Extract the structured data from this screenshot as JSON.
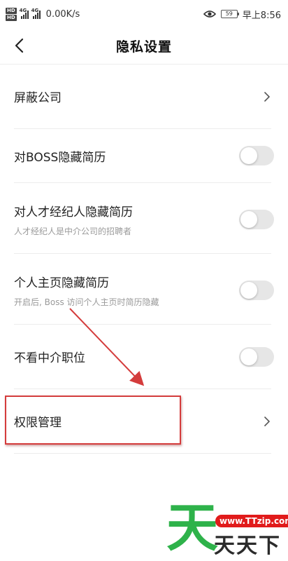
{
  "status_bar": {
    "hd_label": "HD",
    "net_label": "4G",
    "speed": "0.00K/s",
    "battery": "59",
    "time": "早上8:56"
  },
  "header": {
    "title": "隐私设置"
  },
  "settings": {
    "items": [
      {
        "label": "屏蔽公司",
        "control": "chevron"
      },
      {
        "label": "对BOSS隐藏简历",
        "control": "toggle",
        "enabled": false
      },
      {
        "label": "对人才经纪人隐藏简历",
        "sub": "人才经纪人是中介公司的招聘者",
        "control": "toggle",
        "enabled": false
      },
      {
        "label": "个人主页隐藏简历",
        "sub": "开启后, Boss 访问个人主页时简历隐藏",
        "control": "toggle",
        "enabled": false
      },
      {
        "label": "不看中介职位",
        "control": "toggle",
        "enabled": false
      },
      {
        "label": "权限管理",
        "control": "chevron"
      }
    ]
  },
  "watermark": {
    "logo_char": "天",
    "url": "www.TTzip.com",
    "name": "天天下载"
  },
  "colors": {
    "annotation": "#d43c3c",
    "toggle_off": "#e6e6e6",
    "watermark_green": "#2eb24a",
    "watermark_red": "#e11b1b"
  }
}
